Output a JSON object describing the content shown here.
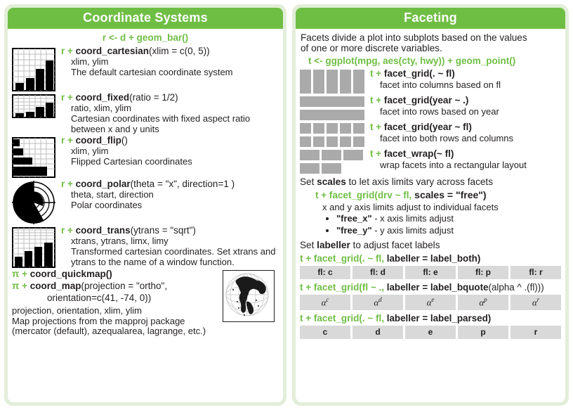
{
  "left_panel": {
    "title": "Coordinate Systems",
    "setup_code": "r <- d + geom_bar()",
    "items": [
      {
        "code_prefix": "r +",
        "fn": "coord_cartesian",
        "args": "(xlim = c(0, 5))",
        "params": "xlim, ylim",
        "desc": "The default cartesian coordinate system",
        "thumb": "bar-chart-thumbnail"
      },
      {
        "code_prefix": "r +",
        "fn": "coord_fixed",
        "args": "(ratio = 1/2)",
        "params": "ratio, xlim, ylim",
        "desc": "Cartesian coordinates with fixed aspect ratio between x and y units",
        "thumb": "squashed-bar-chart-thumbnail"
      },
      {
        "code_prefix": "r +",
        "fn": "coord_flip",
        "args": "()",
        "params": "xlim, ylim",
        "desc": "Flipped Cartesian coordinates",
        "thumb": "horizontal-bar-chart-thumbnail"
      },
      {
        "code_prefix": "r +",
        "fn": "coord_polar",
        "args": "(theta = \"x\", direction=1 )",
        "params": "theta, start, direction",
        "desc": "Polar coordinates",
        "thumb": "polar-pie-thumbnail"
      },
      {
        "code_prefix": "r +",
        "fn": "coord_trans",
        "args": "(ytrans = \"sqrt\")",
        "params": "xtrans, ytrans, limx, limy",
        "desc": "Transformed cartesian coordinates. Set xtrans and ytrans to the name of a window function.",
        "thumb": "transformed-bar-chart-thumbnail"
      }
    ],
    "map": {
      "pi_symbol": "π",
      "plus": "+",
      "quickmap_fn": "coord_quickmap",
      "quickmap_args": "()",
      "map_fn": "coord_map",
      "map_args_line1": "(projection = \"ortho\",",
      "map_args_line2": "orientation=c(41, -74, 0))",
      "params": "projection, orientation, xlim, ylim",
      "desc_line1": "Map projections from the mapproj package",
      "desc_line2": "(mercator (default), azequalarea, lagrange, etc.)",
      "globe_icon": "globe-orthographic-icon"
    }
  },
  "right_panel": {
    "title": "Faceting",
    "intro_line1": "Facets divide a plot into subplots based on the values",
    "intro_line2": "of one or more discrete variables.",
    "setup_code": "t <- ggplot(mpg, aes(cty, hwy)) + geom_point()",
    "facets": [
      {
        "prefix": "t +",
        "fn": "facet_grid",
        "args": "(. ~ fl)",
        "desc": "facet into columns based on fl",
        "thumb": "facet-columns-thumbnail",
        "layout": [
          [
            1,
            1,
            1,
            1,
            1
          ]
        ]
      },
      {
        "prefix": "t +",
        "fn": "facet_grid",
        "args": "(year ~ .)",
        "desc": "facet into rows based on year",
        "thumb": "facet-rows-thumbnail",
        "layout": [
          [
            1
          ],
          [
            1
          ]
        ]
      },
      {
        "prefix": "t +",
        "fn": "facet_grid",
        "args": "(year ~ fl)",
        "desc": "facet into both rows and columns",
        "thumb": "facet-grid-thumbnail",
        "layout": [
          [
            1,
            1,
            1,
            1,
            1
          ],
          [
            1,
            1,
            1,
            1,
            1
          ]
        ]
      },
      {
        "prefix": "t +",
        "fn": "facet_wrap",
        "args": "(~ fl)",
        "desc": "wrap facets into a rectangular layout",
        "thumb": "facet-wrap-thumbnail",
        "layout": [
          [
            1,
            1,
            1
          ],
          [
            1,
            1
          ]
        ]
      }
    ],
    "scales_section": {
      "heading_pre": "Set ",
      "heading_bold": "scales",
      "heading_post": " to let axis limits vary across facets",
      "code_green1": "t + facet_grid(drv ~ fl,",
      "code_bold": " scales = \"free\")",
      "desc": "x and y axis limits adjust to individual facets",
      "bullets": [
        {
          "bold": "\"free_x\"",
          "rest": " - x axis limits adjust"
        },
        {
          "bold": "\"free_y\"",
          "rest": " - y axis limits adjust"
        }
      ]
    },
    "labeller_section": {
      "heading_pre": "Set ",
      "heading_bold": "labeller",
      "heading_post": " to adjust facet labels",
      "examples": [
        {
          "green": "t + facet_grid(. ~ fl,",
          "bold": " labeller = label_both",
          "tail": ")",
          "cells": [
            "fl: c",
            "fl: d",
            "fl: e",
            "fl: p",
            "fl: r"
          ],
          "math": false
        },
        {
          "green": "t + facet_grid(fl ~ .,",
          "bold": " labeller = label_bquote",
          "tail": "(alpha ^ .(fl)))",
          "cells": [
            "c",
            "d",
            "e",
            "p",
            "r"
          ],
          "math": true,
          "math_base": "α"
        },
        {
          "green": "t + facet_grid(. ~ fl,",
          "bold": " labeller = label_parsed",
          "tail": ")",
          "cells": [
            "c",
            "d",
            "e",
            "p",
            "r"
          ],
          "math": false
        }
      ]
    }
  },
  "colors": {
    "brand_green": "#6fbe44",
    "panel_bg": "#e3eeda",
    "text": "#231f20",
    "facet_grey": "#aaaaaa",
    "cell_grey": "#d9d9d9"
  }
}
